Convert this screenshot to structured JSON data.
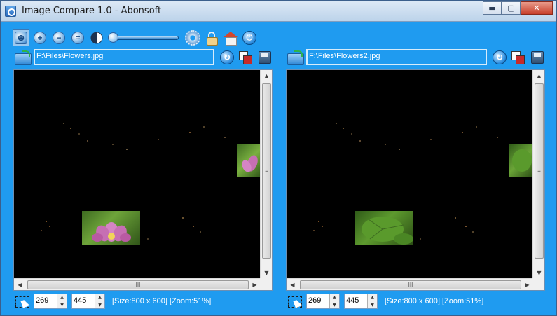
{
  "window": {
    "title": "Image Compare 1.0 - Abonsoft",
    "buttons": {
      "minimize": "▬",
      "maximize": "▢",
      "close": "✕"
    }
  },
  "toolbar": {
    "icons": [
      "compare-mode-icon",
      "zoom-in-icon",
      "zoom-out-icon",
      "zoom-reset-icon",
      "difference-icon",
      "opacity-slider",
      "settings-icon",
      "lock-icon",
      "home-icon",
      "power-icon"
    ],
    "zoom_in": "+",
    "zoom_out": "−",
    "zoom_reset": "=",
    "power": "⏻",
    "slider_level": 0.0
  },
  "left": {
    "path": "F:\\Files\\Flowers.jpg",
    "refresh": "↻",
    "x": "269",
    "y": "445",
    "status": "[Size:800 x 600] [Zoom:51%]",
    "scroll_v_grip": "≡",
    "scroll_h_grip": "III"
  },
  "right": {
    "path": "F:\\Files\\Flowers2.jpg",
    "refresh": "↻",
    "x": "269",
    "y": "445",
    "status": "[Size:800 x 600] [Zoom:51%]",
    "scroll_v_grip": "≡",
    "scroll_h_grip": "III"
  },
  "colors": {
    "window_bg": "#1f9bf0",
    "viewer_bg": "#000000",
    "lotus_pink": "#c76bb0",
    "leaf_green": "#4f9a2e"
  }
}
